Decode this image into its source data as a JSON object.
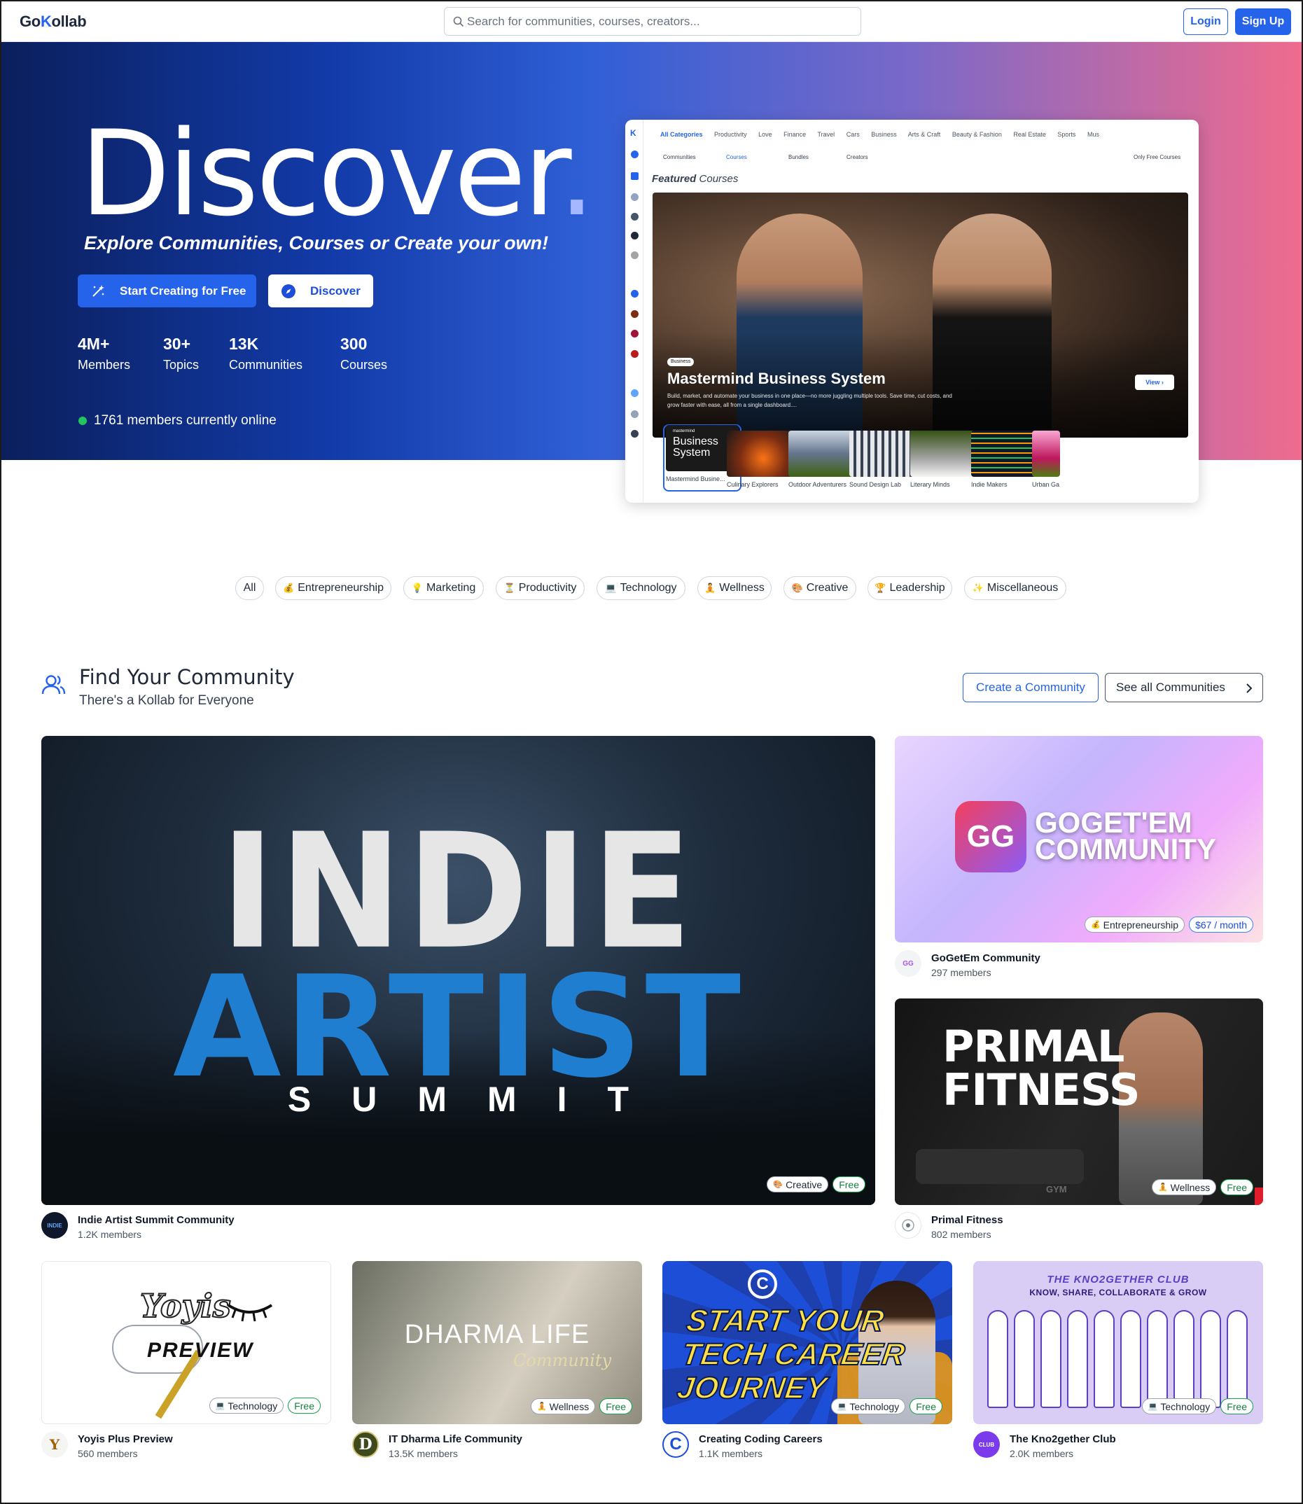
{
  "nav": {
    "logo_text_1": "Go",
    "logo_text_k": "K",
    "logo_text_2": "ollab",
    "search_placeholder": "Search for communities, courses, creators...",
    "login": "Login",
    "signup": "Sign Up"
  },
  "hero": {
    "title": "Discover",
    "title_dot": ".",
    "subtitle": "Explore Communities, Courses or Create your own!",
    "cta_start": "Start Creating for Free",
    "cta_discover": "Discover",
    "stats": [
      {
        "value": "4M+",
        "label": "Members"
      },
      {
        "value": "30+",
        "label": "Topics"
      },
      {
        "value": "13K",
        "label": "Communities"
      },
      {
        "value": "300",
        "label": "Courses"
      }
    ],
    "online": "1761 members currently online"
  },
  "preview": {
    "categories": [
      "All Categories",
      "Productivity",
      "Love",
      "Finance",
      "Travel",
      "Cars",
      "Business",
      "Arts & Craft",
      "Beauty & Fashion",
      "Real Estate",
      "Sports",
      "Mus"
    ],
    "tabs": [
      "Communities",
      "Courses",
      "Bundles",
      "Creators"
    ],
    "only_free": "Only Free Courses",
    "featured_bold": "Featured",
    "featured_rest": " Courses",
    "badge": "Business",
    "course_title": "Mastermind Business System",
    "course_desc": "Build, market, and automate your business in one place—no more juggling multiple tools. Save time, cut costs, and grow faster with ease, all from a single dashboard....",
    "view": "View",
    "thumb_card_small": "mastermind",
    "thumb_card_big": "Business System",
    "thumbs": [
      "Mastermind Busine...",
      "Culinary Explorers",
      "Outdoor Adventurers",
      "Sound Design Lab",
      "Literary Minds",
      "Indie Makers",
      "Urban Ga"
    ]
  },
  "filters": [
    {
      "icon": "",
      "label": "All"
    },
    {
      "icon": "💰",
      "label": "Entrepreneurship"
    },
    {
      "icon": "💡",
      "label": "Marketing"
    },
    {
      "icon": "⏳",
      "label": "Productivity"
    },
    {
      "icon": "💻",
      "label": "Technology"
    },
    {
      "icon": "🧘",
      "label": "Wellness"
    },
    {
      "icon": "🎨",
      "label": "Creative"
    },
    {
      "icon": "🏆",
      "label": "Leadership"
    },
    {
      "icon": "✨",
      "label": "Miscellaneous"
    }
  ],
  "section": {
    "title": "Find Your Community",
    "subtitle": "There's a Kollab for Everyone",
    "create": "Create a Community",
    "see_all": "See all Communities"
  },
  "communities": [
    {
      "name": "Indie Artist Summit Community",
      "members": "1.2K members",
      "category": "Creative",
      "cat_icon": "🎨",
      "price": "Free",
      "art_1": "INDIE",
      "art_2": "ARTIST",
      "art_3": "SUMMIT",
      "avatar": "INDIE"
    },
    {
      "name": "GoGetEm Community",
      "members": "297 members",
      "category": "Entrepreneurship",
      "cat_icon": "💰",
      "price": "$67 / month",
      "art_1": "GOGET'EM",
      "art_2": "COMMUNITY",
      "avatar": "GG"
    },
    {
      "name": "Primal Fitness",
      "members": "802 members",
      "category": "Wellness",
      "cat_icon": "🧘",
      "price": "Free",
      "art_1": "PRIMAL",
      "art_2": "FITNESS",
      "art_3": "GYM"
    },
    {
      "name": "Yoyis Plus Preview",
      "members": "560 members",
      "category": "Technology",
      "cat_icon": "💻",
      "price": "Free",
      "art_1": "Yoyis",
      "art_2": "PREVIEW",
      "avatar": "Y"
    },
    {
      "name": "IT Dharma Life Community",
      "members": "13.5K members",
      "category": "Wellness",
      "cat_icon": "🧘",
      "price": "Free",
      "art_1": "DHARMA LIFE",
      "art_2": "Community",
      "avatar": "D"
    },
    {
      "name": "Creating Coding Careers",
      "members": "1.1K members",
      "category": "Technology",
      "cat_icon": "💻",
      "price": "Free",
      "art_1": "START YOUR",
      "art_2": "TECH CAREER",
      "art_3": "JOURNEY",
      "avatar": "C"
    },
    {
      "name": "The Kno2gether Club",
      "members": "2.0K members",
      "category": "Technology",
      "cat_icon": "💻",
      "price": "Free",
      "art_1": "THE KNO2GETHER CLUB",
      "art_2": "KNOW, SHARE, COLLABORATE & GROW",
      "avatar": "CLUB"
    }
  ],
  "colors": {
    "primary": "#2563eb",
    "online": "#22c55e",
    "free": "#16a34a"
  }
}
